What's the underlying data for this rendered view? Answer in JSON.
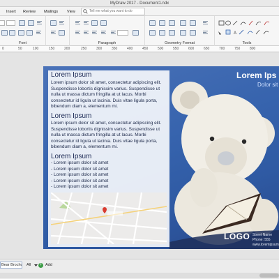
{
  "window": {
    "title": "MyDraw 2017 - Document1.ndx"
  },
  "ribbon_tabs": [
    "Insert",
    "Review",
    "Mailings",
    "View"
  ],
  "tell_me": {
    "placeholder": "Tell me what you want to do"
  },
  "ribbon_groups": {
    "font": "Font",
    "paragraph": "Paragraph",
    "geometry": "Geometry Format",
    "tools": "Tools"
  },
  "ruler_marks": [
    "0",
    "50",
    "100",
    "150",
    "200",
    "250",
    "300",
    "350",
    "400",
    "450",
    "500",
    "550",
    "600",
    "650",
    "700",
    "750",
    "800"
  ],
  "brochure": {
    "sections": [
      {
        "heading": "Lorem Ipsum",
        "body": "Lorem ipsum dolor sit amet, consectetur adipiscing elit. Suspendisse lobortis dignissim varius. Suspendisse ut nulla ut massa dictum fringilla at ut lacus. Morbi consectetur id ligula ut lacinia. Duis vitae ligula porta, bibendum diam a, elementum mi."
      },
      {
        "heading": "Lorem Ipsum",
        "body": "Lorem ipsum dolor sit amet, consectetur adipiscing elit. Suspendisse lobortis dignissim varius. Suspendisse ut nulla ut massa dictum fringilla at ut lacus. Morbi consectetur id ligula ut lacinia. Duis vitae ligula porta, bibendum diam a, elementum mi."
      }
    ],
    "list_heading": "Lorem Ipsum",
    "list_items": [
      "- Lorem ipsum dolor sit amet",
      "- Lorem ipsum dolor sit amet",
      "- Lorem ipsum dolor sit amet",
      "- Lorem ipsum dolor sit amet",
      "- Lorem ipsum dolor sit amet"
    ],
    "right_title": "Lorem Ips",
    "right_subtitle": "Dolor sit",
    "logo": "LOGO",
    "address": [
      "Street Name",
      "Phone: 555",
      "www.loremipsum"
    ]
  },
  "bottom": {
    "page_tab": "Bear Brochure",
    "all_label": "All",
    "add_label": "Add"
  }
}
